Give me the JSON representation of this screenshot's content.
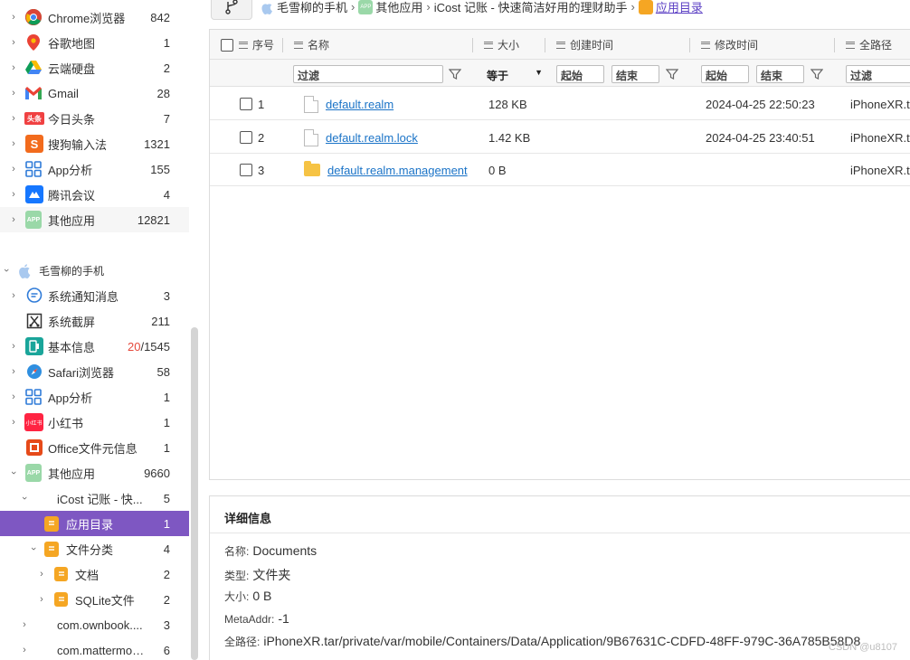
{
  "sidebar": {
    "items": [
      {
        "label": "Chrome浏览器",
        "count": "842",
        "icon": "chrome-icon",
        "color": "#34a853"
      },
      {
        "label": "谷歌地图",
        "count": "1",
        "icon": "google-maps-icon",
        "color": "#ea4335"
      },
      {
        "label": "云端硬盘",
        "count": "2",
        "icon": "google-drive-icon",
        "color": "#fbbc04"
      },
      {
        "label": "Gmail",
        "count": "28",
        "icon": "gmail-icon",
        "color": "#ea4335"
      },
      {
        "label": "今日头条",
        "count": "7",
        "icon": "toutiao-icon",
        "badge": "头条",
        "color": "#f04142"
      },
      {
        "label": "搜狗输入法",
        "count": "1321",
        "icon": "sogou-icon",
        "badge": "S",
        "color": "#f26b1d"
      },
      {
        "label": "App分析",
        "count": "155",
        "icon": "app-analysis-icon",
        "color": "#2f7bd8"
      },
      {
        "label": "腾讯会议",
        "count": "4",
        "icon": "tencent-meeting-icon",
        "color": "#1677ff"
      },
      {
        "label": "其他应用",
        "count": "12821",
        "icon": "other-apps-icon",
        "badge": "APP",
        "color": "#9ad8a8"
      }
    ],
    "device": {
      "label": "毛雪柳的手机",
      "icon": "apple-icon"
    },
    "device_items": [
      {
        "label": "系统通知消息",
        "count": "3",
        "icon": "notification-icon",
        "color": "#2f7bd8"
      },
      {
        "label": "系统截屏",
        "count": "211",
        "icon": "screenshot-icon",
        "color": "#333333"
      },
      {
        "label": "基本信息",
        "count_red": "20",
        "count_rest": "/1545",
        "icon": "basic-info-icon",
        "color": "#1aa59a"
      },
      {
        "label": "Safari浏览器",
        "count": "58",
        "icon": "safari-icon",
        "color": "#2f8fe0"
      },
      {
        "label": "App分析",
        "count": "1",
        "icon": "app-analysis-icon",
        "color": "#2f7bd8"
      },
      {
        "label": "小红书",
        "count": "1",
        "icon": "xiaohongshu-icon",
        "badge": "小红书",
        "color": "#ff2442"
      },
      {
        "label": "Office文件元信息",
        "count": "1",
        "icon": "office-icon",
        "color": "#e64a19"
      },
      {
        "label": "其他应用",
        "count": "9660",
        "icon": "other-apps-icon",
        "badge": "APP",
        "color": "#9ad8a8"
      },
      {
        "label": "iCost 记账 - 快...",
        "count": "5"
      },
      {
        "label": "应用目录",
        "count": "1",
        "icon": "folder-doc-icon",
        "color": "#f5a623"
      },
      {
        "label": "文件分类",
        "count": "4",
        "icon": "folder-doc-icon",
        "color": "#f5a623"
      },
      {
        "label": "文档",
        "count": "2",
        "icon": "folder-doc-icon",
        "color": "#f5a623"
      },
      {
        "label": "SQLite文件",
        "count": "2",
        "icon": "folder-doc-icon",
        "color": "#f5a623"
      },
      {
        "label": "com.ownbook....",
        "count": "3"
      },
      {
        "label": "com.mattermos...",
        "count": "6"
      }
    ]
  },
  "breadcrumb": {
    "items": [
      "毛雪柳的手机",
      "其他应用",
      "iCost 记账 - 快速简洁好用的理财助手"
    ],
    "current": "应用目录"
  },
  "grid": {
    "columns": [
      "序号",
      "名称",
      "大小",
      "创建时间",
      "修改时间",
      "全路径"
    ],
    "filters": {
      "name_placeholder": "过滤",
      "size_op": "等于",
      "start": "起始",
      "end": "结束",
      "start2": "起始",
      "end2": "结束",
      "path_placeholder": "过滤"
    },
    "rows": [
      {
        "index": "1",
        "name": "default.realm",
        "size": "128 KB",
        "created": "",
        "modified": "2024-04-25 22:50:23",
        "path": "iPhoneXR.t",
        "type": "file"
      },
      {
        "index": "2",
        "name": "default.realm.lock",
        "size": "1.42 KB",
        "created": "",
        "modified": "2024-04-25 23:40:51",
        "path": "iPhoneXR.t",
        "type": "file"
      },
      {
        "index": "3",
        "name": "default.realm.management",
        "size": "0 B",
        "created": "",
        "modified": "",
        "path": "iPhoneXR.t",
        "type": "folder"
      }
    ]
  },
  "detail": {
    "title": "详细信息",
    "fields": [
      {
        "key": "名称:",
        "value": "Documents"
      },
      {
        "key": "类型:",
        "value": "文件夹"
      },
      {
        "key": "大小:",
        "value": "0 B"
      },
      {
        "key": "MetaAddr:",
        "value": "-1"
      },
      {
        "key": "全路径:",
        "value": "iPhoneXR.tar/private/var/mobile/Containers/Data/Application/9B67631C-CDFD-48FF-979C-36A785B58D8"
      }
    ],
    "watermark": "CSDN @u8107"
  },
  "colors": {
    "accent": "#7e57c2",
    "link": "#1a73c7",
    "breadcrumb_current": "#5b3fc4",
    "folder": "#f6c344"
  }
}
